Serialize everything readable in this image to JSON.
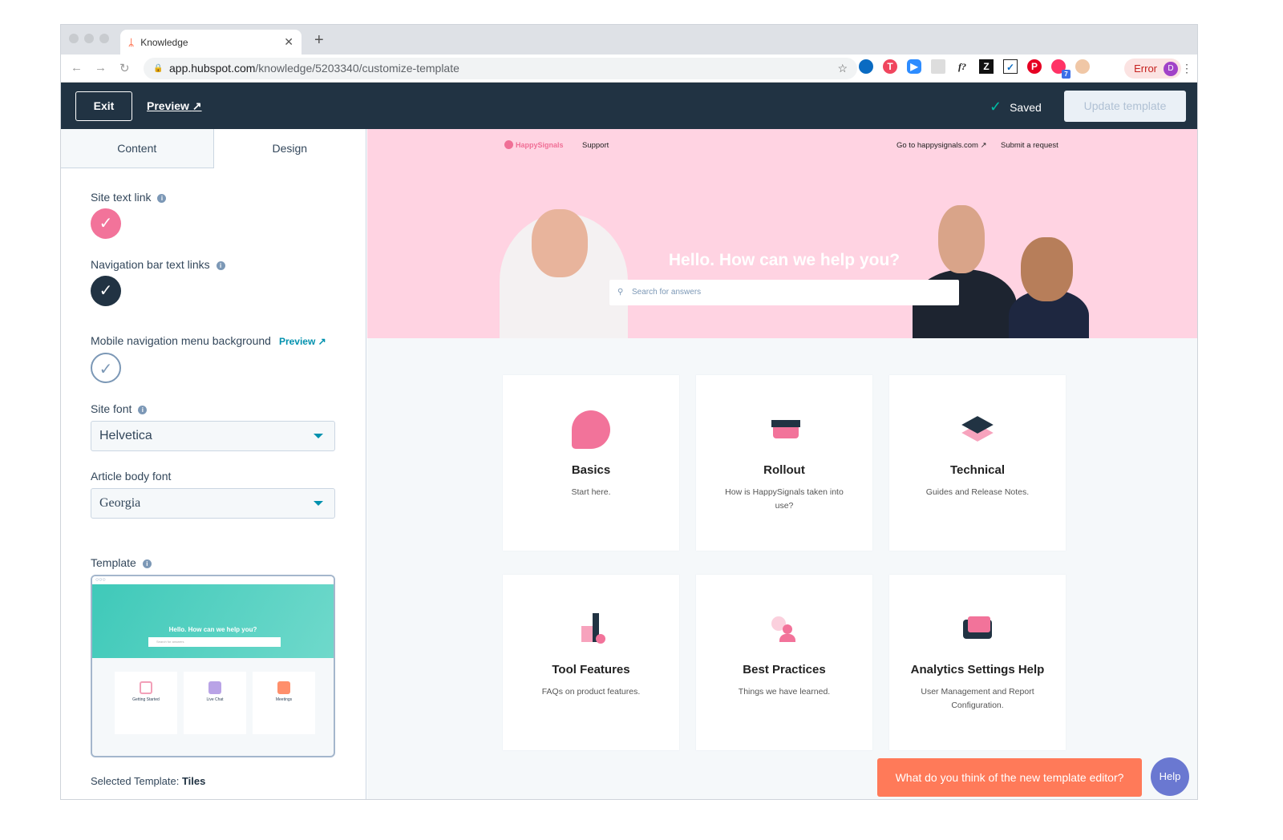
{
  "browser": {
    "tab_title": "Knowledge",
    "url_host": "app.hubspot.com",
    "url_path": "/knowledge/5203340/customize-template",
    "error_label": "Error",
    "avatar_letter": "D",
    "ext_badge": "7"
  },
  "header": {
    "exit": "Exit",
    "preview": "Preview",
    "saved": "Saved",
    "update": "Update template"
  },
  "left": {
    "tabs": [
      "Content",
      "Design"
    ],
    "active_tab": "Design",
    "site_text_link": "Site text link",
    "site_text_link_color": "#f2739a",
    "nav_links": "Navigation bar text links",
    "nav_links_color": "#213343",
    "mobile_bg": "Mobile navigation menu background",
    "mobile_preview": "Preview",
    "mobile_bg_color": "#ffffff",
    "site_font_label": "Site font",
    "site_font": "Helvetica",
    "article_font_label": "Article body font",
    "article_font": "Georgia",
    "template_label": "Template",
    "thumb": {
      "title": "Hello. How can we help you?",
      "search": "Search for answers",
      "cards": [
        "Getting Started",
        "Live Chat",
        "Meetings"
      ]
    },
    "selected_prefix": "Selected Template:",
    "selected_value": "Tiles"
  },
  "preview": {
    "brand": "HappySignals",
    "nav": [
      "Support"
    ],
    "right_nav": [
      "Go to happysignals.com",
      "Submit a request"
    ],
    "hero_title": "Hello. How can we help you?",
    "search_placeholder": "Search for answers",
    "hero_color": "#ffd3e2",
    "cards": [
      {
        "title": "Basics",
        "desc": "Start here.",
        "icon": "heart-bubble-icon"
      },
      {
        "title": "Rollout",
        "desc": "How is HappySignals taken into use?",
        "icon": "box-icon"
      },
      {
        "title": "Technical",
        "desc": "Guides and Release Notes.",
        "icon": "layers-icon"
      },
      {
        "title": "Tool Features",
        "desc": "FAQs on product features.",
        "icon": "tools-icon"
      },
      {
        "title": "Best Practices",
        "desc": "Things we have learned.",
        "icon": "people-icon"
      },
      {
        "title": "Analytics Settings Help",
        "desc": "User Management and Report Configuration.",
        "icon": "laptop-smile-icon"
      }
    ],
    "feedback": "What do you think of the new template editor?",
    "help": "Help"
  }
}
